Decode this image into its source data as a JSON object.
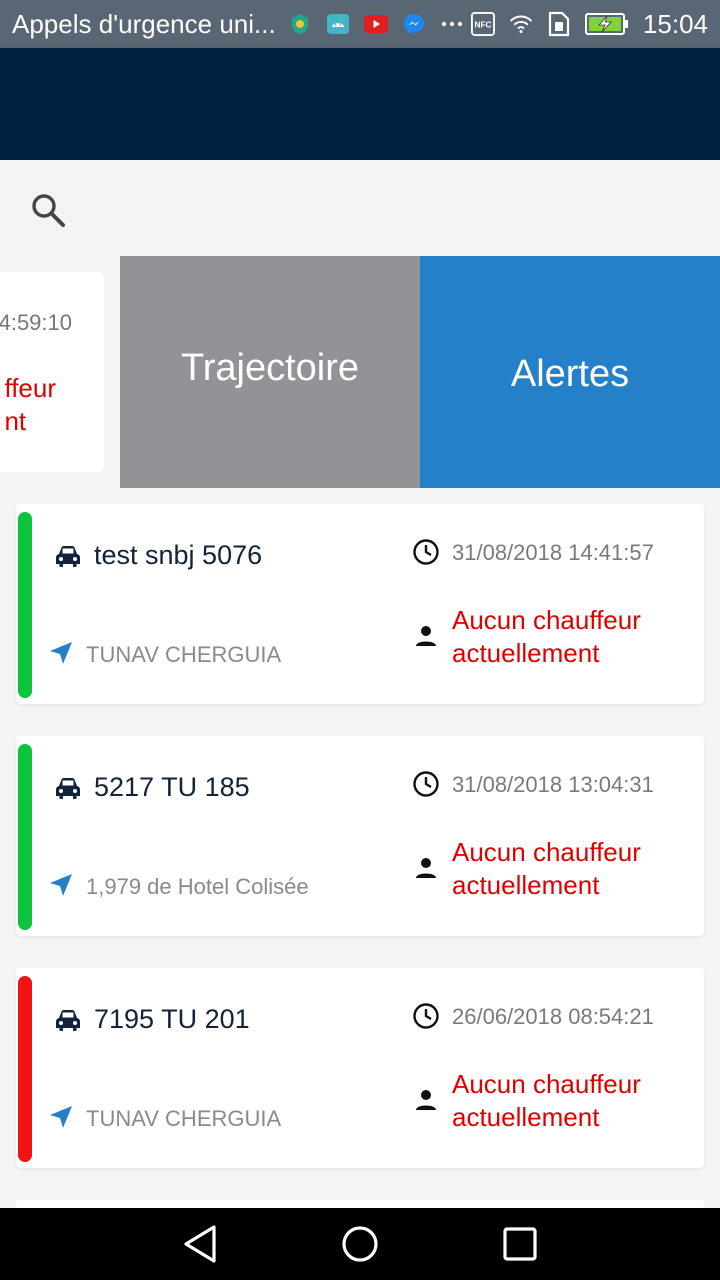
{
  "status_bar": {
    "title": "Appels d'urgence uni...",
    "time": "15:04",
    "icons": [
      "vpn-shield-icon",
      "android-icon",
      "youtube-icon",
      "messenger-icon",
      "more-dots-icon",
      "nfc-icon",
      "wifi-icon",
      "sim-icon",
      "battery-charging-icon"
    ],
    "nfc_label": "NFC"
  },
  "search": {
    "icon": "search-icon"
  },
  "swiped_item": {
    "time_fragment": "4:59:10",
    "driver_fragment_1": "ffeur",
    "driver_fragment_2": "nt"
  },
  "actions": {
    "trajectory_label": "Trajectoire",
    "alerts_label": "Alertes",
    "trajectory_color": "#929396",
    "alerts_color": "#2380c9"
  },
  "vehicles": [
    {
      "plate": "test snbj 5076",
      "location": "TUNAV CHERGUIA",
      "datetime": "31/08/2018 14:41:57",
      "driver": "Aucun chauffeur actuellement",
      "status_color": "#0cc43c"
    },
    {
      "plate": "5217 TU 185",
      "location": "1,979 de Hotel Colisée",
      "datetime": "31/08/2018 13:04:31",
      "driver": "Aucun chauffeur actuellement",
      "status_color": "#0cc43c"
    },
    {
      "plate": "7195 TU 201",
      "location": "TUNAV CHERGUIA",
      "datetime": "26/06/2018 08:54:21",
      "driver": "Aucun chauffeur actuellement",
      "status_color": "#f21313"
    }
  ],
  "colors": {
    "toolbar": "#022241",
    "status_bar": "#596673",
    "driver_text": "#e00000"
  }
}
